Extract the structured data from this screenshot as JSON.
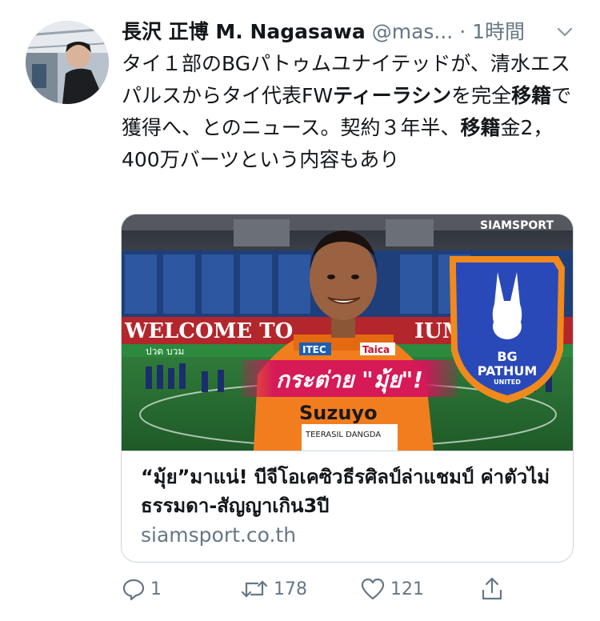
{
  "tweet": {
    "author_name": "長沢 正博 M. Nagasawa",
    "handle": "@mas...",
    "time": "· 1時間",
    "text_parts": [
      {
        "t": "タイ１部のBGパトゥムユナイテッドが、清水エスパルスからタイ代表FW",
        "b": false
      },
      {
        "t": "ティーラシン",
        "b": true
      },
      {
        "t": "を完全",
        "b": false
      },
      {
        "t": "移籍",
        "b": true
      },
      {
        "t": "で獲得へ、とのニュース。契約３年半、",
        "b": false
      },
      {
        "t": "移籍",
        "b": true
      },
      {
        "t": "金2，400万バーツという内容もあり",
        "b": false
      }
    ]
  },
  "card": {
    "image": {
      "watermark": "SIAMSPORT",
      "banner_text": "WELCOME TO",
      "banner_suffix": "IUM",
      "caption": "กระต่าย \"มุ้ย\"!",
      "badge_line1": "BG",
      "badge_line2": "PATHUM",
      "badge_line3": "UNITED",
      "sponsor_left": "ITEC",
      "sponsor_right": "Taica",
      "shirt_sponsor": "Suzuyo",
      "player_name": "TEERASIL DANGDA",
      "board_text": "ปวด บวม"
    },
    "title": "“มุ้ย”มาแน่! บีจีโอเคซิวธีรศิลป์ล่าแชมป์ ค่าตัวไม่ธรรมดา-สัญญาเกิน3ปี",
    "domain": "siamsport.co.th"
  },
  "actions": {
    "reply_count": "1",
    "retweet_count": "178",
    "like_count": "121"
  },
  "colors": {
    "secondary_text": "#657786",
    "border": "#ccd6dd",
    "badge_blue": "#2a49b8",
    "badge_orange": "#f08a1c",
    "caption_magenta": "#d4145a"
  }
}
